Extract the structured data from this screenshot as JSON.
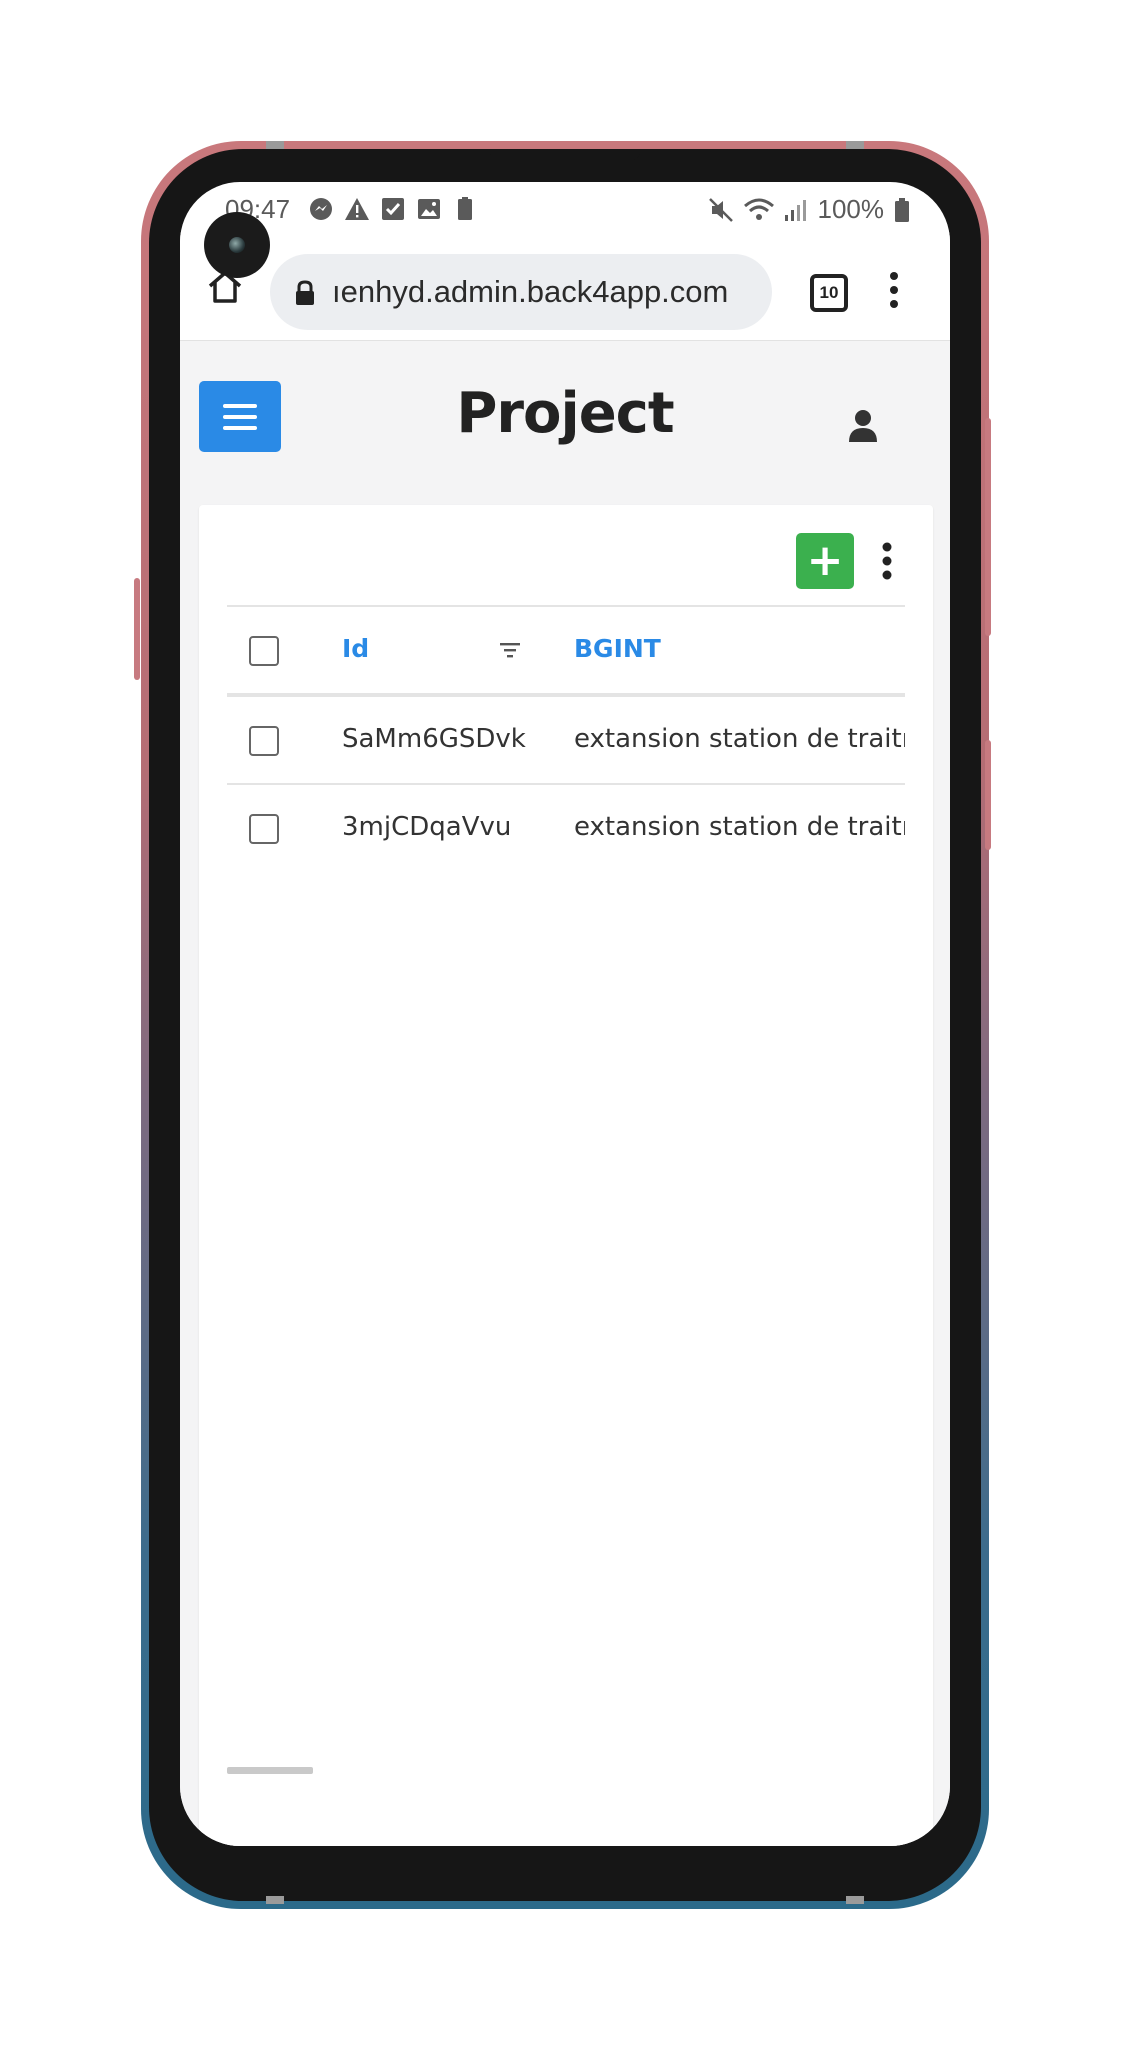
{
  "status_bar": {
    "time": "09:47",
    "battery": "100%",
    "left_icons": [
      "messenger-icon",
      "warning-icon",
      "check-icon",
      "image-icon",
      "battery-100-icon"
    ],
    "right_icons": [
      "mute-icon",
      "wifi-icon",
      "signal-icon",
      "battery-icon"
    ]
  },
  "browser": {
    "url": "ıenhyd.admin.back4app.com",
    "tab_count": "10"
  },
  "app": {
    "title": "Project"
  },
  "table": {
    "columns": [
      "Id",
      "BGINT"
    ],
    "rows": [
      {
        "id": "SaMm6GSDvk",
        "bgint": "extansion station de traitm"
      },
      {
        "id": "3mjCDqaVvu",
        "bgint": "extansion station de traitm"
      }
    ]
  },
  "toolbar": {
    "add_label": "+"
  },
  "colors": {
    "accent": "#2a8ae6",
    "add_button": "#3bb04e",
    "app_background": "#f4f4f5"
  }
}
